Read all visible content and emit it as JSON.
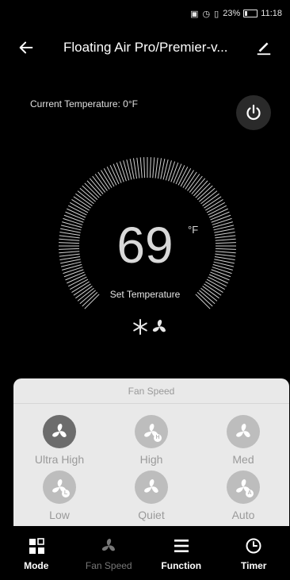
{
  "status_bar": {
    "battery": "23%",
    "time": "11:18"
  },
  "header": {
    "title": "Floating Air Pro/Premier-v..."
  },
  "current_temperature": "Current Temperature: 0°F",
  "thermostat": {
    "set_value": "69",
    "unit": "°F",
    "label": "Set Temperature"
  },
  "fan_speed_sheet": {
    "title": "Fan Speed",
    "selected": "Ultra High",
    "options": [
      {
        "label": "Ultra High",
        "badge": ""
      },
      {
        "label": "High",
        "badge": "H"
      },
      {
        "label": "Med",
        "badge": ""
      },
      {
        "label": "Low",
        "badge": "L"
      },
      {
        "label": "Quiet",
        "badge": ""
      },
      {
        "label": "Auto",
        "badge": "A"
      }
    ]
  },
  "nav": [
    {
      "label": "Mode",
      "icon": "mode-icon"
    },
    {
      "label": "Fan Speed",
      "icon": "fan-icon"
    },
    {
      "label": "Function",
      "icon": "menu-icon"
    },
    {
      "label": "Timer",
      "icon": "clock-icon"
    }
  ],
  "colors": {
    "background": "#000000",
    "sheet": "#e9e9e9",
    "selected_option": "#6c6c6c",
    "option": "#bdbdbd"
  }
}
